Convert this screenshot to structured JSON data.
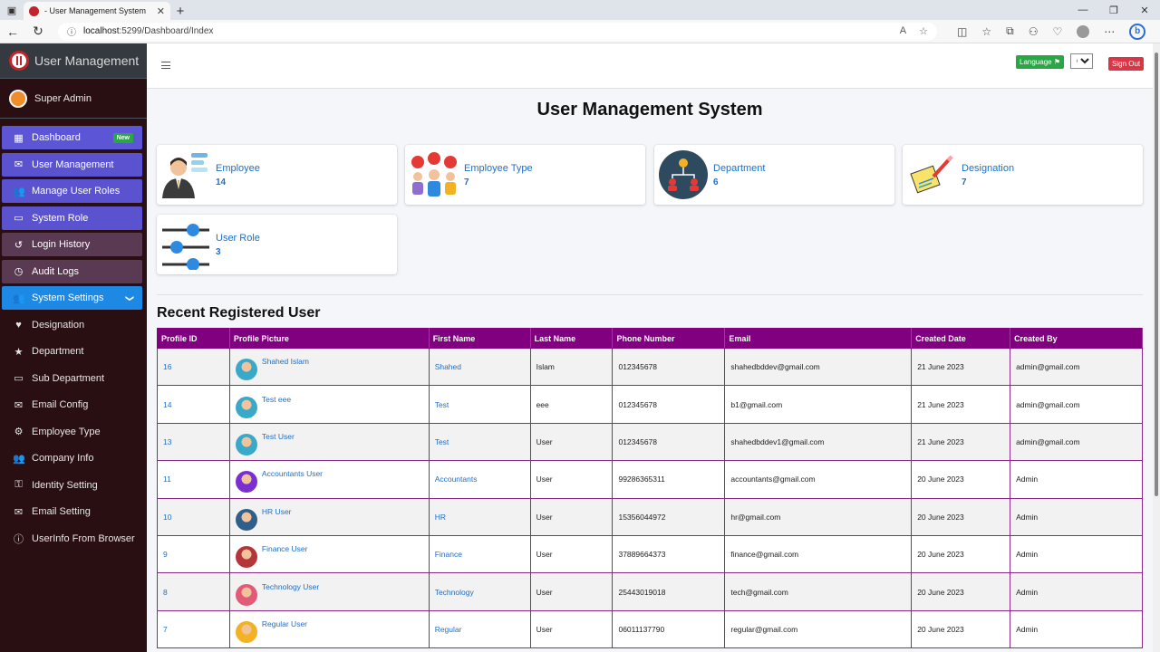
{
  "browser": {
    "tab_title": "- User Management System",
    "url_host": "localhost",
    "url_path": ":5299/Dashboard/Index"
  },
  "sidebar": {
    "brand": "User Management",
    "user": "Super Admin",
    "items": [
      {
        "label": "Dashboard",
        "icon": "grid-icon",
        "badge": "New"
      },
      {
        "label": "User Management",
        "icon": "envelope-icon"
      },
      {
        "label": "Manage User Roles",
        "icon": "users-icon"
      },
      {
        "label": "System Role",
        "icon": "monitor-icon"
      },
      {
        "label": "Login History",
        "icon": "history-icon"
      },
      {
        "label": "Audit Logs",
        "icon": "clock-icon"
      },
      {
        "label": "System Settings",
        "icon": "users-icon"
      },
      {
        "label": "Designation",
        "icon": "heart-icon"
      },
      {
        "label": "Department",
        "icon": "star-icon"
      },
      {
        "label": "Sub Department",
        "icon": "monitor-icon"
      },
      {
        "label": "Email Config",
        "icon": "envelope-icon"
      },
      {
        "label": "Employee Type",
        "icon": "user-gear-icon"
      },
      {
        "label": "Company Info",
        "icon": "users-icon"
      },
      {
        "label": "Identity Setting",
        "icon": "user-lock-icon"
      },
      {
        "label": "Email Setting",
        "icon": "envelope-icon"
      },
      {
        "label": "UserInfo From Browser",
        "icon": "info-icon"
      }
    ]
  },
  "topnav": {
    "language_label": "Language",
    "language_value": "en",
    "signout_label": "Sign Out"
  },
  "main": {
    "title": "User Management System",
    "cards": [
      {
        "label": "Employee",
        "value": "14"
      },
      {
        "label": "Employee Type",
        "value": "7"
      },
      {
        "label": "Department",
        "value": "6"
      },
      {
        "label": "Designation",
        "value": "7"
      },
      {
        "label": "User Role",
        "value": "3"
      }
    ],
    "recent_title": "Recent Registered User",
    "table": {
      "headers": [
        "Profile ID",
        "Profile Picture",
        "First Name",
        "Last Name",
        "Phone Number",
        "Email",
        "Created Date",
        "Created By"
      ],
      "rows": [
        {
          "id": "16",
          "name": "Shahed Islam",
          "first": "Shahed",
          "last": "Islam",
          "phone": "012345678",
          "email": "shahedbddev@gmail.com",
          "date": "21 June 2023",
          "by": "admin@gmail.com",
          "pic": "#38a9c9"
        },
        {
          "id": "14",
          "name": "Test eee",
          "first": "Test",
          "last": "eee",
          "phone": "012345678",
          "email": "b1@gmail.com",
          "date": "21 June 2023",
          "by": "admin@gmail.com",
          "pic": "#38a9c9"
        },
        {
          "id": "13",
          "name": "Test User",
          "first": "Test",
          "last": "User",
          "phone": "012345678",
          "email": "shahedbddev1@gmail.com",
          "date": "21 June 2023",
          "by": "admin@gmail.com",
          "pic": "#38a9c9"
        },
        {
          "id": "11",
          "name": "Accountants User",
          "first": "Accountants",
          "last": "User",
          "phone": "99286365311",
          "email": "accountants@gmail.com",
          "date": "20 June 2023",
          "by": "Admin",
          "pic": "#7b2fd1"
        },
        {
          "id": "10",
          "name": "HR User",
          "first": "HR",
          "last": "User",
          "phone": "15356044972",
          "email": "hr@gmail.com",
          "date": "20 June 2023",
          "by": "Admin",
          "pic": "#2f5f8a"
        },
        {
          "id": "9",
          "name": "Finance User",
          "first": "Finance",
          "last": "User",
          "phone": "37889664373",
          "email": "finance@gmail.com",
          "date": "20 June 2023",
          "by": "Admin",
          "pic": "#b5363a"
        },
        {
          "id": "8",
          "name": "Technology User",
          "first": "Technology",
          "last": "User",
          "phone": "25443019018",
          "email": "tech@gmail.com",
          "date": "20 June 2023",
          "by": "Admin",
          "pic": "#e25a78"
        },
        {
          "id": "7",
          "name": "Regular User",
          "first": "Regular",
          "last": "User",
          "phone": "06011137790",
          "email": "regular@gmail.com",
          "date": "20 June 2023",
          "by": "Admin",
          "pic": "#f2b224"
        }
      ]
    }
  }
}
